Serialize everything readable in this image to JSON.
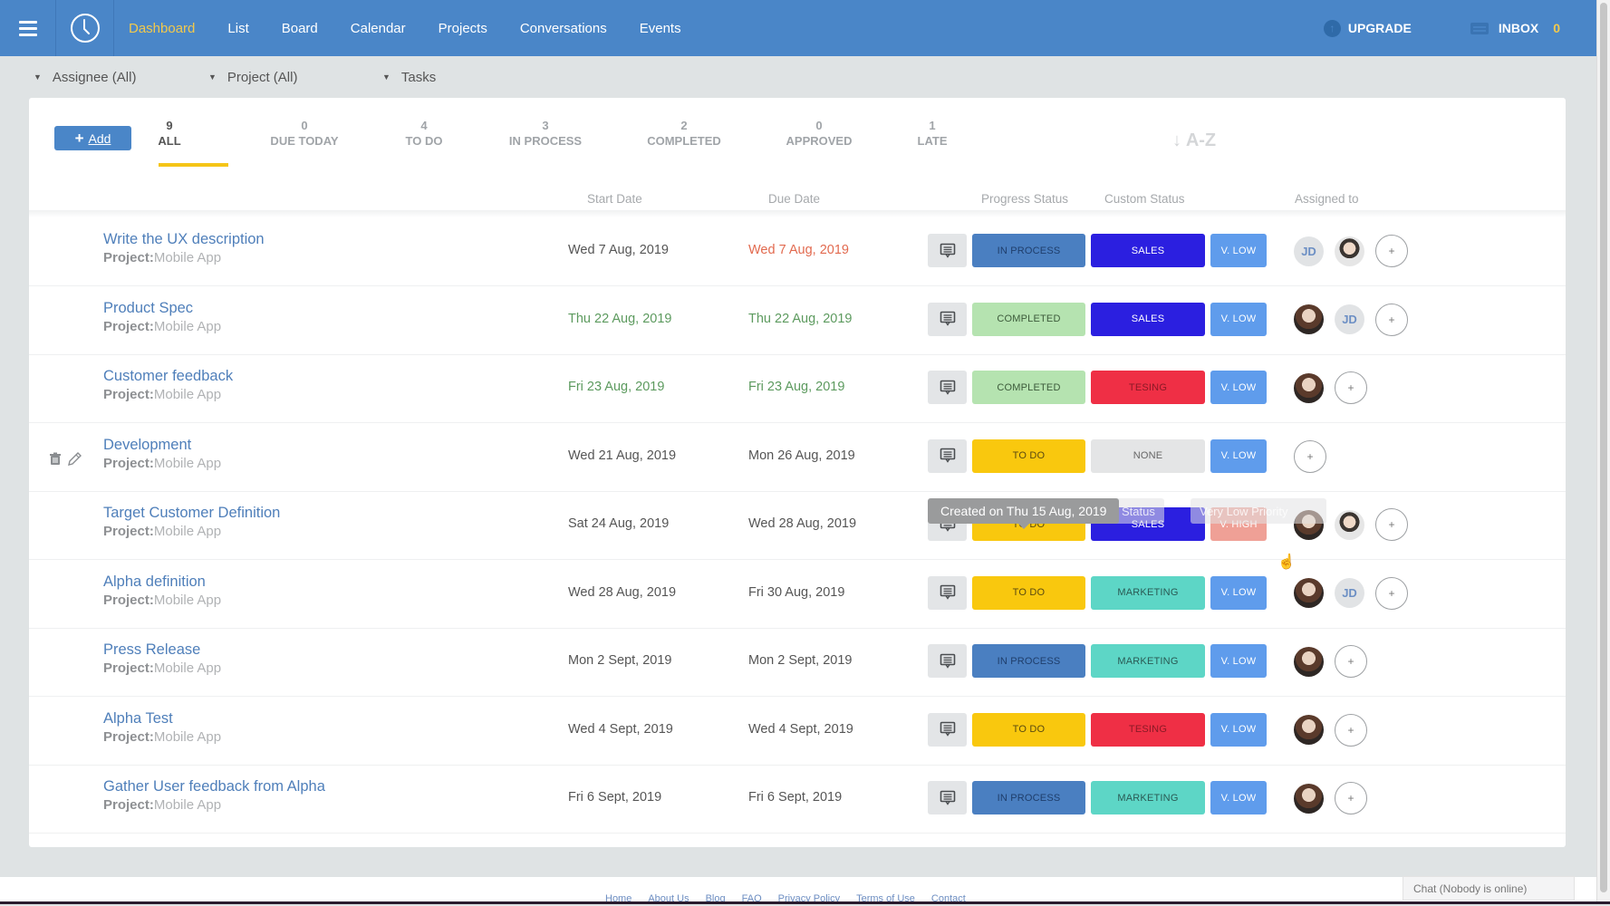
{
  "topbar": {
    "nav": [
      {
        "label": "Dashboard",
        "active": true
      },
      {
        "label": "List"
      },
      {
        "label": "Board"
      },
      {
        "label": "Calendar"
      },
      {
        "label": "Projects"
      },
      {
        "label": "Conversations"
      },
      {
        "label": "Events"
      }
    ],
    "upgrade_label": "UPGRADE",
    "inbox_label": "INBOX",
    "inbox_count": "0",
    "colors": {
      "bar": "#4a86c8",
      "active_nav": "#f2c94c"
    }
  },
  "filters": {
    "assignee": "Assignee (All)",
    "project": "Project (All)",
    "tasks": "Tasks"
  },
  "toolbar": {
    "add_label": "Add",
    "sort_label": "↓ A-Z"
  },
  "tabs": [
    {
      "count": "9",
      "label": "ALL",
      "active": true
    },
    {
      "count": "0",
      "label": "DUE TODAY"
    },
    {
      "count": "4",
      "label": "TO DO"
    },
    {
      "count": "3",
      "label": "IN PROCESS"
    },
    {
      "count": "2",
      "label": "COMPLETED"
    },
    {
      "count": "0",
      "label": "APPROVED"
    },
    {
      "count": "1",
      "label": "LATE"
    }
  ],
  "columns": {
    "start": "Start Date",
    "due": "Due Date",
    "progress": "Progress Status",
    "custom": "Custom Status",
    "assigned": "Assigned to"
  },
  "project_prefix": "Project:",
  "status_colors": {
    "IN PROCESS": {
      "bg": "#4a7fc1",
      "fg": "#1f3e6b"
    },
    "COMPLETED": {
      "bg": "#b5e3b0",
      "fg": "#3c5a3a"
    },
    "TO DO": {
      "bg": "#f9c80e",
      "fg": "#5a4a10"
    },
    "SALES": {
      "bg": "#2b1fe0",
      "fg": "#ffffff"
    },
    "TESING": {
      "bg": "#ef2f45",
      "fg": "#8a1a26"
    },
    "NONE": {
      "bg": "#e4e5e6",
      "fg": "#666666"
    },
    "MARKETING": {
      "bg": "#5dd6c6",
      "fg": "#2a5a54"
    },
    "V. LOW": {
      "bg": "#5f9cec",
      "fg": "#ffffff"
    },
    "V. HIGH": {
      "bg": "#efa096",
      "fg": "#ffffff"
    }
  },
  "tasks": [
    {
      "title": "Write the UX description",
      "project": "Mobile App",
      "start": "Wed 7 Aug, 2019",
      "due": "Wed 7 Aug, 2019",
      "start_color": "",
      "due_color": "red",
      "progress": "IN PROCESS",
      "custom": "SALES",
      "priority": "V. LOW",
      "assignees": [
        "JD",
        "man",
        "add"
      ]
    },
    {
      "title": "Product Spec",
      "project": "Mobile App",
      "start": "Thu 22 Aug, 2019",
      "due": "Thu 22 Aug, 2019",
      "start_color": "green",
      "due_color": "green",
      "progress": "COMPLETED",
      "custom": "SALES",
      "priority": "V. LOW",
      "assignees": [
        "woman",
        "JD",
        "add"
      ]
    },
    {
      "title": "Customer feedback",
      "project": "Mobile App",
      "start": "Fri 23 Aug, 2019",
      "due": "Fri 23 Aug, 2019",
      "start_color": "green",
      "due_color": "green",
      "progress": "COMPLETED",
      "custom": "TESING",
      "priority": "V. LOW",
      "assignees": [
        "woman",
        "add"
      ]
    },
    {
      "title": "Development",
      "project": "Mobile App",
      "start": "Wed 21 Aug, 2019",
      "due": "Mon 26 Aug, 2019",
      "start_color": "",
      "due_color": "",
      "progress": "TO DO",
      "custom": "NONE",
      "priority": "V. LOW",
      "assignees": [
        "add"
      ],
      "hovered": true
    },
    {
      "title": "Target Customer Definition",
      "project": "Mobile App",
      "start": "Sat 24 Aug, 2019",
      "due": "Wed 28 Aug, 2019",
      "start_color": "",
      "due_color": "",
      "progress": "TO DO",
      "custom": "SALES",
      "priority": "V. HIGH",
      "assignees": [
        "woman",
        "man",
        "add"
      ]
    },
    {
      "title": "Alpha definition",
      "project": "Mobile App",
      "start": "Wed 28 Aug, 2019",
      "due": "Fri 30 Aug, 2019",
      "start_color": "",
      "due_color": "",
      "progress": "TO DO",
      "custom": "MARKETING",
      "priority": "V. LOW",
      "assignees": [
        "woman",
        "JD",
        "add"
      ]
    },
    {
      "title": "Press Release",
      "project": "Mobile App",
      "start": "Mon 2 Sept, 2019",
      "due": "Mon 2 Sept, 2019",
      "start_color": "",
      "due_color": "",
      "progress": "IN PROCESS",
      "custom": "MARKETING",
      "priority": "V. LOW",
      "assignees": [
        "woman",
        "add"
      ]
    },
    {
      "title": "Alpha Test",
      "project": "Mobile App",
      "start": "Wed 4 Sept, 2019",
      "due": "Wed 4 Sept, 2019",
      "start_color": "",
      "due_color": "",
      "progress": "TO DO",
      "custom": "TESING",
      "priority": "V. LOW",
      "assignees": [
        "woman",
        "add"
      ]
    },
    {
      "title": "Gather User feedback from Alpha",
      "project": "Mobile App",
      "start": "Fri 6 Sept, 2019",
      "due": "Fri 6 Sept, 2019",
      "start_color": "",
      "due_color": "",
      "progress": "IN PROCESS",
      "custom": "MARKETING",
      "priority": "V. LOW",
      "assignees": [
        "woman",
        "add"
      ]
    }
  ],
  "tooltip": {
    "text": "Created on Thu 15 Aug, 2019",
    "ghost_custom": "Status",
    "ghost_priority": "Very Low Priority"
  },
  "footer": {
    "links": [
      "Home",
      "About Us",
      "Blog",
      "FAQ",
      "Privacy Policy",
      "Terms of Use",
      "Contact"
    ],
    "chat": "Chat (Nobody is online)"
  }
}
